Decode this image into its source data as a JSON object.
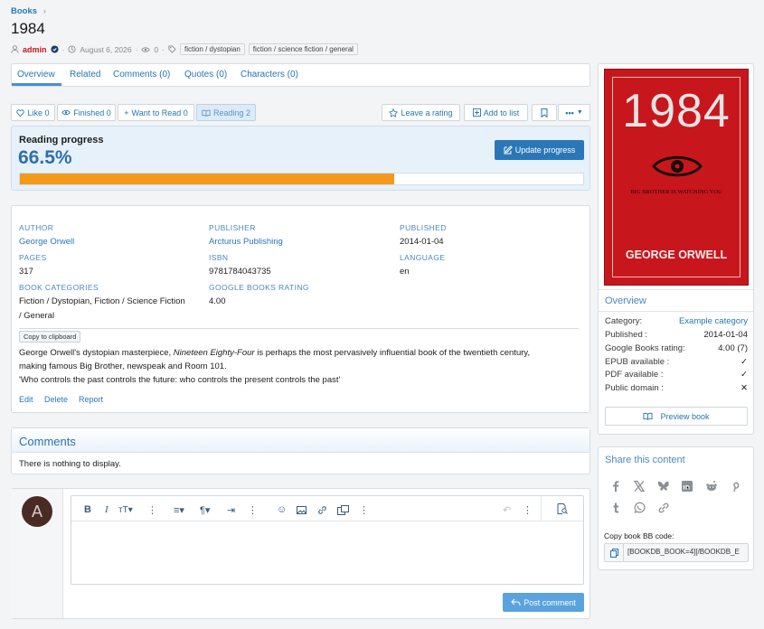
{
  "breadcrumb": {
    "label": "Books",
    "chevron": "›"
  },
  "title": "1984",
  "meta": {
    "author": "admin",
    "date": "August 6, 2026",
    "views": "0",
    "tags": [
      "fiction / dystopian",
      "fiction / science fiction / general"
    ]
  },
  "tabs": [
    "Overview",
    "Related",
    "Comments (0)",
    "Quotes (0)",
    "Characters (0)"
  ],
  "reactions": {
    "like": "Like 0",
    "finished": "Finished 0",
    "want": "Want to Read 0",
    "reading": "Reading 2",
    "rate": "Leave a rating",
    "addlist": "Add to list"
  },
  "progress": {
    "title": "Reading progress",
    "value": "66.5%",
    "percent": 66.5,
    "button": "Update progress",
    "accent": "#f39a1d"
  },
  "details": {
    "author": {
      "label": "AUTHOR",
      "value": "George Orwell"
    },
    "publisher": {
      "label": "PUBLISHER",
      "value": "Arcturus Publishing"
    },
    "published": {
      "label": "PUBLISHED",
      "value": "2014-01-04"
    },
    "pages": {
      "label": "PAGES",
      "value": "317"
    },
    "isbn": {
      "label": "ISBN",
      "value": "9781784043735"
    },
    "language": {
      "label": "LANGUAGE",
      "value": "en"
    },
    "categories": {
      "label": "BOOK CATEGORIES",
      "value1": "Fiction / Dystopian, Fiction / Science Fiction",
      "value2": "/ General"
    },
    "rating": {
      "label": "GOOGLE BOOKS RATING",
      "value": "4.00"
    }
  },
  "copy_clipboard": "Copy to clipboard",
  "description": {
    "p1a": "George Orwell's dystopian masterpiece, ",
    "p1i": "Nineteen Eighty-Four",
    "p1b": " is perhaps the most pervasively influential book of the twentieth century,",
    "p2": "making famous Big Brother, newspeak and Room 101.",
    "p3": "'Who controls the past controls the future: who controls the present controls the past'"
  },
  "actions": {
    "edit": "Edit",
    "delete": "Delete",
    "report": "Report"
  },
  "comments": {
    "title": "Comments",
    "empty": "There is nothing to display."
  },
  "editor": {
    "avatar_letter": "A",
    "post": "Post comment"
  },
  "cover": {
    "title": "1984",
    "tagline": "BIG BROTHER IS WATCHING YOU",
    "author": "GEORGE ORWELL",
    "bg": "#c8161d"
  },
  "overview": {
    "title": "Overview",
    "category_label": "Category:",
    "category_value": "Example category",
    "published_label": "Published :",
    "published_value": "2014-01-04",
    "rating_label": "Google Books rating:",
    "rating_value": "4.00 (7)",
    "epub_label": "EPUB available :",
    "epub_value": "✓",
    "pdf_label": "PDF available :",
    "pdf_value": "✓",
    "public_label": "Public domain :",
    "public_value": "✕",
    "preview": "Preview book"
  },
  "share": {
    "title": "Share this content",
    "bb_label": "Copy book BB code:",
    "bb_value": "[BOOKDB_BOOK=4][/BOOKDB_E"
  }
}
